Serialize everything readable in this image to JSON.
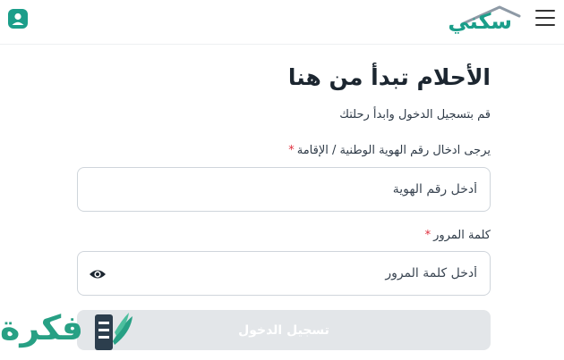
{
  "header": {
    "brand": "سكني",
    "menu_icon": "hamburger-menu-icon",
    "account_icon": "user-account-icon"
  },
  "hero": {
    "title": "الأحلام تبدأ من هنا",
    "subtitle": "قم بتسجيل الدخول وابدأ رحلتك"
  },
  "form": {
    "id_label": "يرجى ادخال رقم الهوية الوطنية / الإقامة",
    "id_placeholder": "أدخل رقم الهوية",
    "password_label": "كلمة المرور",
    "password_placeholder": "أدخل كلمة المرور",
    "required_mark": "*",
    "submit_label": "تسجيل الدخول"
  },
  "watermark": {
    "text": "فكرة"
  },
  "colors": {
    "brand": "#1b9e8a",
    "required": "#e02e3d",
    "disabled_button": "#e3e6e9"
  }
}
